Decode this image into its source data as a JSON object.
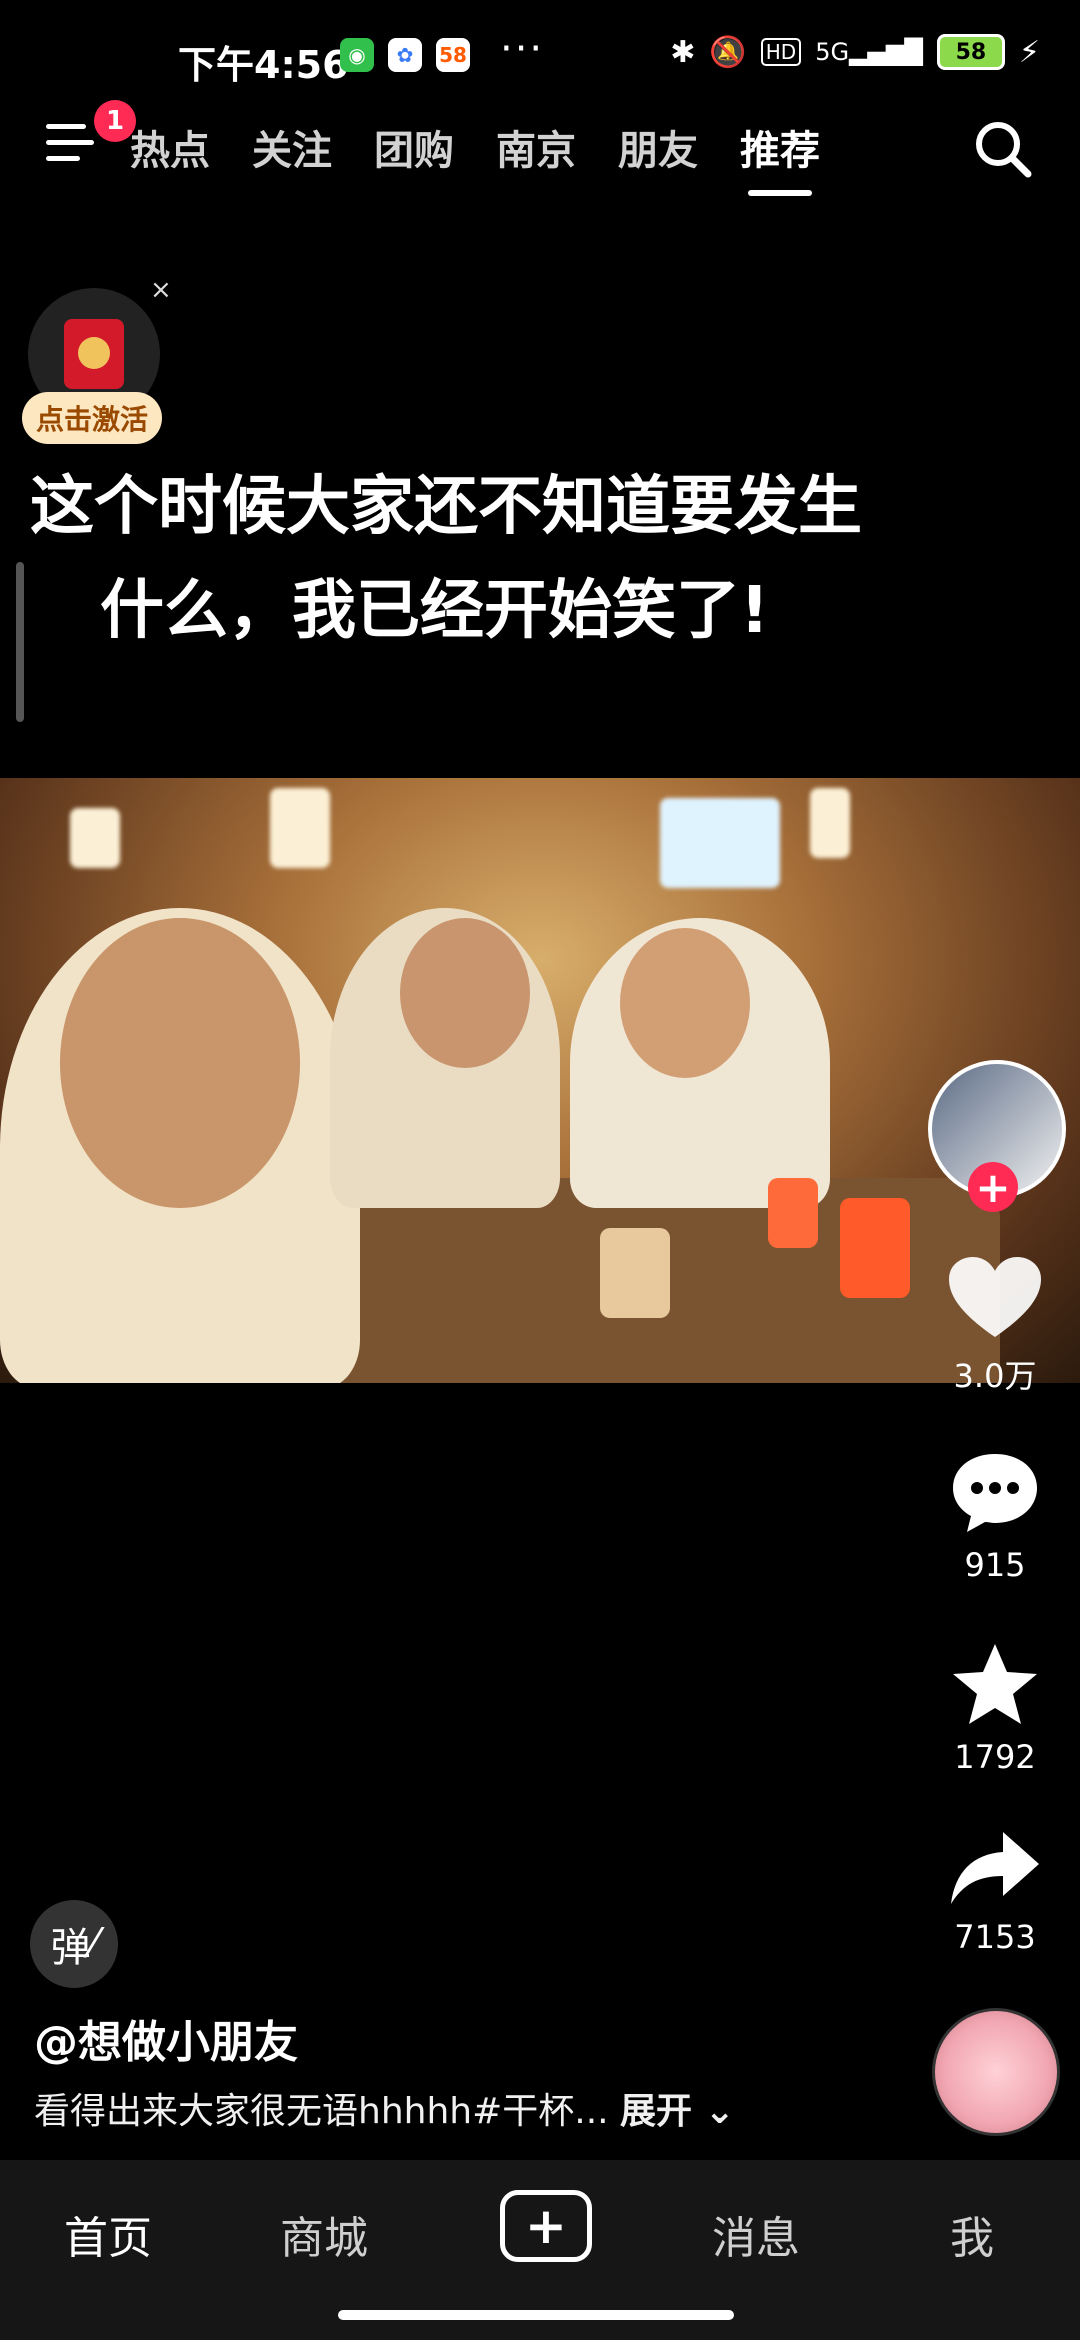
{
  "status_bar": {
    "time": "下午4:56",
    "chip_58": "58",
    "more": "···",
    "battery": "58"
  },
  "top_nav": {
    "badge": "1",
    "tabs": [
      "热点",
      "关注",
      "团购",
      "南京",
      "朋友",
      "推荐"
    ],
    "active_tab": "推荐"
  },
  "red_packet": {
    "label": "点击激活",
    "close": "×"
  },
  "caption": {
    "line1": "这个时候大家还不知道要发生",
    "line2": "什么，我已经开始笑了!"
  },
  "actions": {
    "likes": "3.0万",
    "comments": "915",
    "favorites": "1792",
    "shares": "7153"
  },
  "video_info": {
    "danmu_label": "弹",
    "author": "@想做小朋友",
    "description": "看得出来大家很无语hhhhh#干杯...",
    "expand": "展开"
  },
  "bottom_nav": {
    "home": "首页",
    "mall": "商城",
    "add": "+",
    "messages": "消息",
    "me": "我"
  },
  "colors": {
    "accent": "#ff2b55",
    "background": "#000000",
    "nav_bg": "#161616"
  }
}
